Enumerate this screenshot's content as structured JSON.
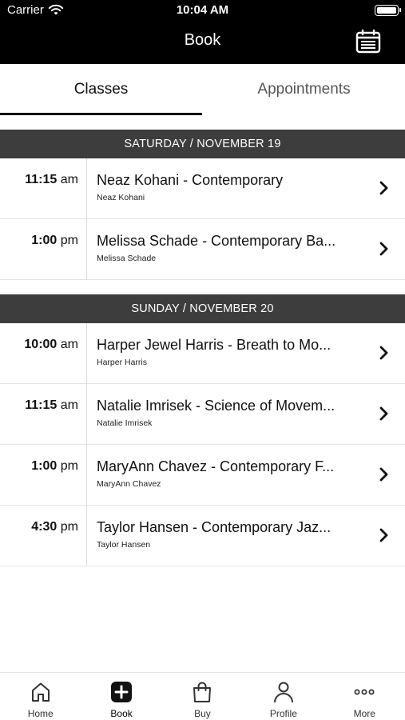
{
  "status_bar": {
    "carrier": "Carrier",
    "time": "10:04 AM"
  },
  "header": {
    "title": "Book"
  },
  "tabs": [
    {
      "label": "Classes"
    },
    {
      "label": "Appointments"
    }
  ],
  "sections": [
    {
      "header": "SATURDAY / NOVEMBER 19",
      "rows": [
        {
          "time": "11:15",
          "ampm": "am",
          "class_name": "Neaz Kohani - Contemporary",
          "instructor": "Neaz Kohani"
        },
        {
          "time": "1:00",
          "ampm": "pm",
          "class_name": "Melissa Schade - Contemporary Ba...",
          "instructor": "Melissa Schade"
        }
      ]
    },
    {
      "header": "SUNDAY / NOVEMBER 20",
      "rows": [
        {
          "time": "10:00",
          "ampm": "am",
          "class_name": "Harper Jewel Harris - Breath to Mo...",
          "instructor": "Harper Harris"
        },
        {
          "time": "11:15",
          "ampm": "am",
          "class_name": "Natalie Imrisek - Science of Movem...",
          "instructor": "Natalie Imrisek"
        },
        {
          "time": "1:00",
          "ampm": "pm",
          "class_name": "MaryAnn Chavez - Contemporary F...",
          "instructor": "MaryAnn Chavez"
        },
        {
          "time": "4:30",
          "ampm": "pm",
          "class_name": "Taylor Hansen - Contemporary Jaz...",
          "instructor": "Taylor Hansen"
        }
      ]
    }
  ],
  "bottom_nav": [
    {
      "label": "Home",
      "icon": "home-icon"
    },
    {
      "label": "Book",
      "icon": "plus-square-icon"
    },
    {
      "label": "Buy",
      "icon": "shopping-bag-icon"
    },
    {
      "label": "Profile",
      "icon": "person-icon"
    },
    {
      "label": "More",
      "icon": "more-dots-icon"
    }
  ]
}
